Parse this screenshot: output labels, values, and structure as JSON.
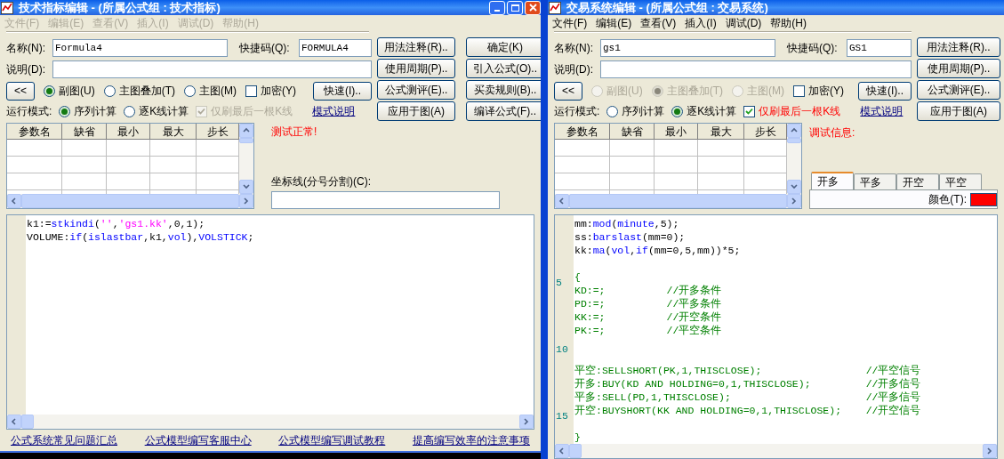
{
  "windows": [
    {
      "kind": "indicator",
      "title": "技术指标编辑 - (所属公式组 : 技术指标)",
      "menu": [
        {
          "label": "文件(F)",
          "disabled": true
        },
        {
          "label": "编辑(E)",
          "disabled": true
        },
        {
          "label": "查看(V)",
          "disabled": true
        },
        {
          "label": "插入(I)",
          "disabled": true
        },
        {
          "label": "调试(D)",
          "disabled": true
        },
        {
          "label": "帮助(H)",
          "disabled": true
        }
      ],
      "name_field": {
        "label": "名称(N):",
        "value": "Formula4"
      },
      "shortcut_field": {
        "label": "快捷码(Q):",
        "value": "FORMULA4"
      },
      "description_field": {
        "label": "说明(D):"
      },
      "collapse_button": "<<",
      "chart_types": [
        {
          "label": "副图(U)",
          "selected": true,
          "disabled": false
        },
        {
          "label": "主图叠加(T)",
          "selected": false,
          "disabled": false
        },
        {
          "label": "主图(M)",
          "selected": false,
          "disabled": false
        }
      ],
      "encrypt": {
        "label": "加密(Y)",
        "checked": false
      },
      "quick_button": "快速(I)..",
      "run_mode": {
        "label": "运行模式:",
        "options": [
          {
            "label": "序列计算",
            "selected": true
          },
          {
            "label": "逐K线计算",
            "selected": false
          }
        ],
        "last_bar_only": {
          "label": "仅刷最后一根K线",
          "checked": true,
          "disabled": true
        },
        "link": "模式说明"
      },
      "buttons": [
        "用法注释(R)..",
        "确定(K)",
        "使用周期(P)..",
        "引入公式(O)..",
        "公式测评(E)..",
        "买卖规则(B)..",
        "应用于图(A)",
        "编译公式(F).."
      ],
      "params_table": {
        "columns": [
          "参数名",
          "缺省",
          "最小",
          "最大",
          "步长"
        ]
      },
      "message": "测试正常!",
      "axis_field": {
        "label": "坐标线(分号分割)(C):"
      },
      "editor": {
        "lines": [
          {
            "segments": [
              {
                "text": "k1:=",
                "kind": "plain"
              },
              {
                "text": "stkindi",
                "kind": "keyword"
              },
              {
                "text": "(",
                "kind": "plain"
              },
              {
                "text": "''",
                "kind": "string"
              },
              {
                "text": ",",
                "kind": "plain"
              },
              {
                "text": "'gs1.kk'",
                "kind": "string"
              },
              {
                "text": ",0,1);",
                "kind": "plain"
              }
            ]
          },
          {
            "segments": [
              {
                "text": "VOLUME:",
                "kind": "plain"
              },
              {
                "text": "if",
                "kind": "keyword"
              },
              {
                "text": "(",
                "kind": "plain"
              },
              {
                "text": "islastbar",
                "kind": "keyword"
              },
              {
                "text": ",k1,",
                "kind": "plain"
              },
              {
                "text": "vol",
                "kind": "keyword"
              },
              {
                "text": "),",
                "kind": "plain"
              },
              {
                "text": "VOLSTICK",
                "kind": "keyword"
              },
              {
                "text": ";",
                "kind": "plain"
              }
            ]
          }
        ]
      },
      "footer_links": [
        "公式系统常见问题汇总",
        "公式模型编写客服中心",
        "公式模型编写调试教程",
        "提高编写效率的注意事项"
      ]
    },
    {
      "kind": "system",
      "title": "交易系统编辑 - (所属公式组 : 交易系统)",
      "menu": [
        {
          "label": "文件(F)",
          "disabled": false
        },
        {
          "label": "编辑(E)",
          "disabled": false
        },
        {
          "label": "查看(V)",
          "disabled": false
        },
        {
          "label": "插入(I)",
          "disabled": false
        },
        {
          "label": "调试(D)",
          "disabled": false
        },
        {
          "label": "帮助(H)",
          "disabled": false
        }
      ],
      "name_field": {
        "label": "名称(N):",
        "value": "gs1"
      },
      "shortcut_field": {
        "label": "快捷码(Q):",
        "value": "GS1"
      },
      "description_field": {
        "label": "说明(D):"
      },
      "collapse_button": "<<",
      "chart_types": [
        {
          "label": "副图(U)",
          "selected": false,
          "disabled": true
        },
        {
          "label": "主图叠加(T)",
          "selected": true,
          "disabled": true
        },
        {
          "label": "主图(M)",
          "selected": false,
          "disabled": true
        }
      ],
      "encrypt": {
        "label": "加密(Y)",
        "checked": false
      },
      "quick_button": "快速(I)..",
      "run_mode": {
        "label": "运行模式:",
        "options": [
          {
            "label": "序列计算",
            "selected": false
          },
          {
            "label": "逐K线计算",
            "selected": true
          }
        ],
        "last_bar_only": {
          "label": "仅刷最后一根K线",
          "checked": true,
          "disabled": false
        },
        "link": "模式说明"
      },
      "buttons": [
        "用法注释(R)..",
        "使用周期(P)..",
        "公式测评(E)..",
        "应用于图(A)"
      ],
      "params_table": {
        "columns": [
          "参数名",
          "缺省",
          "最小",
          "最大",
          "步长"
        ]
      },
      "message": "调试信息:",
      "signal_tabs": [
        {
          "label": "开多",
          "selected": true
        },
        {
          "label": "平多",
          "selected": false
        },
        {
          "label": "开空",
          "selected": false
        },
        {
          "label": "平空",
          "selected": false
        }
      ],
      "color_field": {
        "label": "颜色(T):",
        "color": "#ff0000"
      },
      "editor": {
        "lines": [
          {
            "segments": [
              {
                "text": "mm:",
                "kind": "plain"
              },
              {
                "text": "mod",
                "kind": "keyword"
              },
              {
                "text": "(",
                "kind": "plain"
              },
              {
                "text": "minute",
                "kind": "keyword"
              },
              {
                "text": ",5);",
                "kind": "plain"
              }
            ]
          },
          {
            "segments": [
              {
                "text": "ss:",
                "kind": "plain"
              },
              {
                "text": "barslast",
                "kind": "keyword"
              },
              {
                "text": "(mm=0);",
                "kind": "plain"
              }
            ]
          },
          {
            "segments": [
              {
                "text": "kk:",
                "kind": "plain"
              },
              {
                "text": "ma",
                "kind": "keyword"
              },
              {
                "text": "(",
                "kind": "plain"
              },
              {
                "text": "vol",
                "kind": "keyword"
              },
              {
                "text": ",",
                "kind": "plain"
              },
              {
                "text": "if",
                "kind": "keyword"
              },
              {
                "text": "(mm=0,5,mm))*5;",
                "kind": "plain"
              }
            ]
          },
          {
            "kind": "blank"
          },
          {
            "number": "5",
            "segments": [
              {
                "text": "{",
                "kind": "comment"
              }
            ]
          },
          {
            "segments": [
              {
                "text": "KD:=;          //开多条件",
                "kind": "comment"
              }
            ]
          },
          {
            "segments": [
              {
                "text": "PD:=;          //平多条件",
                "kind": "comment"
              }
            ]
          },
          {
            "segments": [
              {
                "text": "KK:=;          //开空条件",
                "kind": "comment"
              }
            ]
          },
          {
            "segments": [
              {
                "text": "PK:=;          //平空条件",
                "kind": "comment"
              }
            ]
          },
          {
            "kind": "blank",
            "number": "10"
          },
          {
            "kind": "blank"
          },
          {
            "segments": [
              {
                "text": "平空:SELLSHORT(PK,1,THISCLOSE);                 //平空信号",
                "kind": "comment"
              }
            ]
          },
          {
            "segments": [
              {
                "text": "开多:BUY(KD AND HOLDING=0,1,THISCLOSE);         //开多信号",
                "kind": "comment"
              }
            ]
          },
          {
            "segments": [
              {
                "text": "平多:SELL(PD,1,THISCLOSE);                      //平多信号",
                "kind": "comment"
              }
            ]
          },
          {
            "number": "15",
            "segments": [
              {
                "text": "开空:BUYSHORT(KK AND HOLDING=0,1,THISCLOSE);    //开空信号",
                "kind": "comment"
              }
            ]
          },
          {
            "kind": "blank"
          },
          {
            "segments": [
              {
                "text": "}",
                "kind": "comment"
              }
            ]
          }
        ]
      }
    }
  ]
}
